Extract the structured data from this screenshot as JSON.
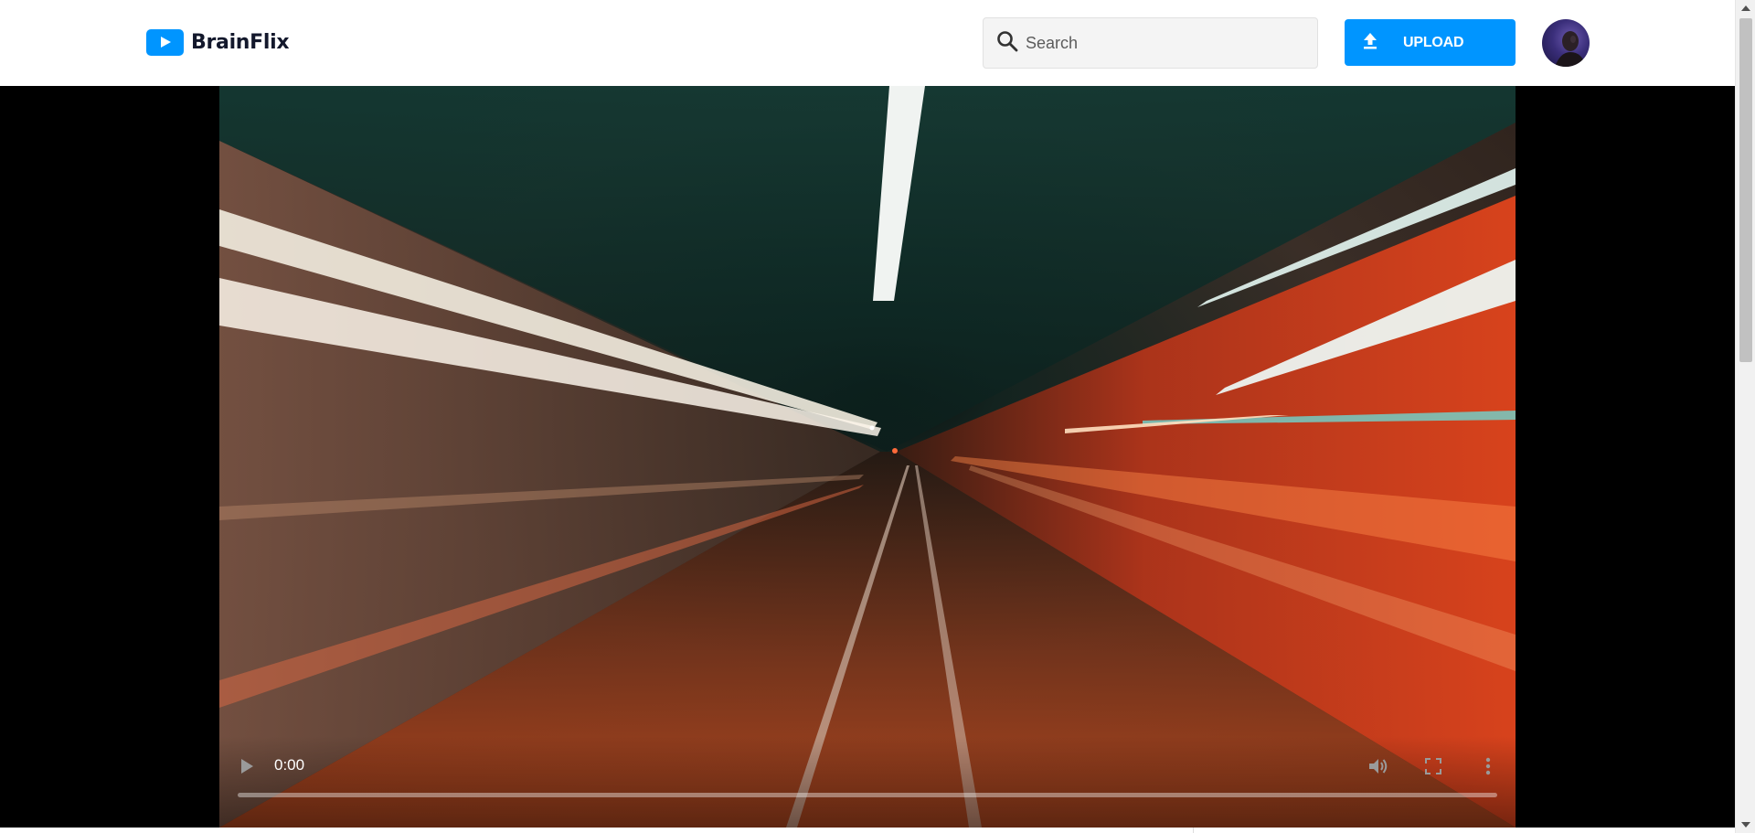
{
  "brand": {
    "name": "BrainFlix",
    "accent": "#0095ff"
  },
  "header": {
    "search": {
      "placeholder": "Search",
      "value": ""
    },
    "upload_label": "UPLOAD",
    "avatar_icon": "user-avatar"
  },
  "video": {
    "current_time": "0:00",
    "progress": 0,
    "controls": [
      "play-icon",
      "volume-icon",
      "fullscreen-icon",
      "more-vert-icon"
    ]
  }
}
